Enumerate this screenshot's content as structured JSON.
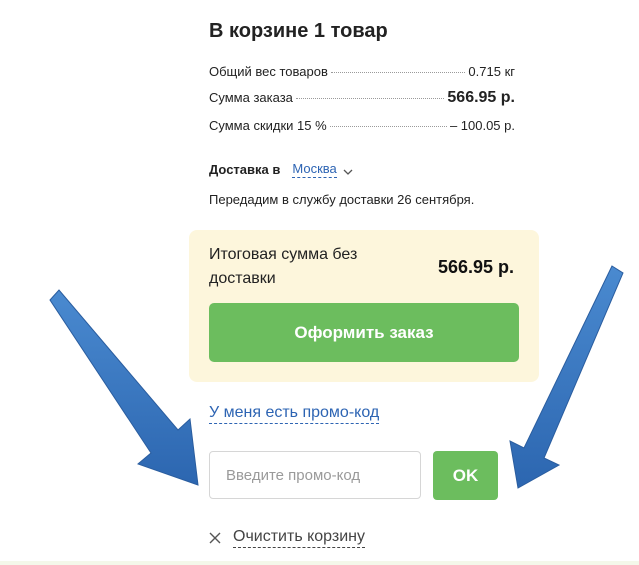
{
  "cart": {
    "title": "В корзине 1 товар",
    "summary": [
      {
        "label": "Общий вес товаров",
        "value": "0.715 кг"
      },
      {
        "label": "Сумма заказа",
        "value": "566.95 р."
      },
      {
        "label": "Сумма скидки 15 %",
        "value": "– 100.05 р."
      }
    ]
  },
  "delivery": {
    "label": "Доставка в",
    "city": "Москва",
    "note": "Передадим в службу доставки 26 сентября."
  },
  "total": {
    "label": "Итоговая сумма без доставки",
    "value": "566.95 р.",
    "checkout_label": "Оформить заказ"
  },
  "promo": {
    "link_label": "У меня есть промо-код",
    "placeholder": "Введите промо-код",
    "value": "",
    "ok_label": "OK"
  },
  "clear": {
    "label": "Очистить корзину"
  },
  "colors": {
    "accent_green": "#6cbd5e",
    "link_blue": "#2d64b3",
    "total_bg": "#fdf6dc",
    "annotation_arrow": "#3a78c3"
  },
  "icons": {
    "city_dropdown": "chevron-down-icon",
    "clear": "close-icon",
    "annotation": "arrow-icon"
  }
}
